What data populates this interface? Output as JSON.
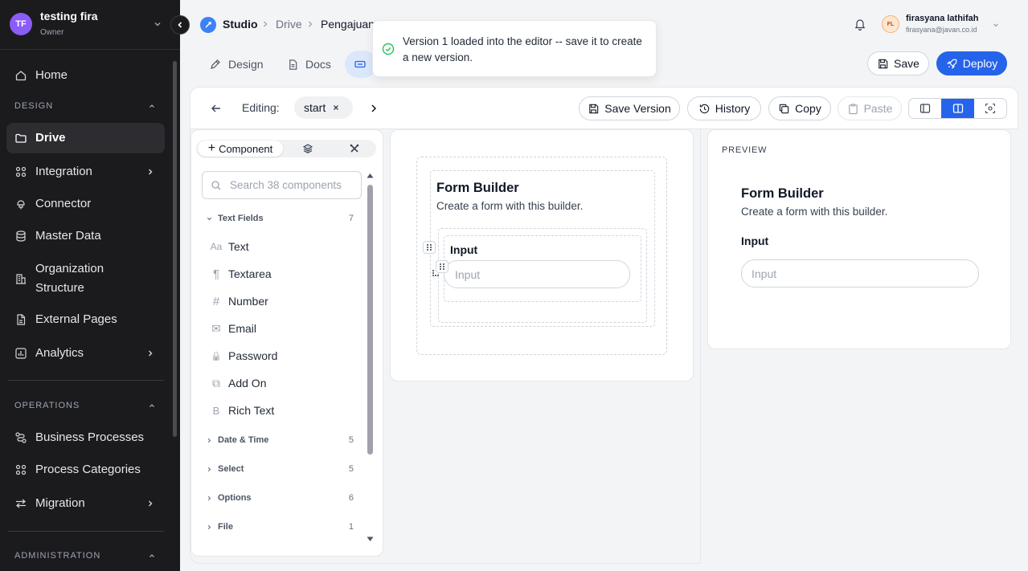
{
  "workspace": {
    "initials": "TF",
    "name": "testing fira",
    "role": "Owner"
  },
  "sidebar": {
    "home": "Home",
    "sections": {
      "design": "DESIGN",
      "operations": "OPERATIONS",
      "administration": "ADMINISTRATION"
    },
    "design_items": [
      {
        "label": "Drive",
        "icon": "folder-icon",
        "active": true
      },
      {
        "label": "Integration",
        "icon": "grid-icon"
      },
      {
        "label": "Connector",
        "icon": "plug-icon"
      },
      {
        "label": "Master Data",
        "icon": "database-icon"
      },
      {
        "label": "Organization Structure",
        "icon": "building-icon"
      },
      {
        "label": "External Pages",
        "icon": "file-icon"
      },
      {
        "label": "Analytics",
        "icon": "chart-icon"
      }
    ],
    "operations_items": [
      {
        "label": "Business Processes",
        "icon": "workflow-icon"
      },
      {
        "label": "Process Categories",
        "icon": "grid-icon"
      },
      {
        "label": "Migration",
        "icon": "arrows-icon"
      }
    ]
  },
  "header": {
    "app": "Studio",
    "breadcrumb": [
      "Drive",
      "Pengajuan"
    ],
    "user": {
      "initials": "FL",
      "name": "firasyana lathifah",
      "email": "firasyana@javan.co.id"
    }
  },
  "tabs": {
    "design": "Design",
    "docs": "Docs"
  },
  "actions": {
    "save": "Save",
    "deploy": "Deploy"
  },
  "toast": {
    "message": "Version 1 loaded into the editor -- save it to create a new version."
  },
  "editor": {
    "editing_label": "Editing:",
    "chip": "start",
    "toolbar": {
      "save_version": "Save Version",
      "history": "History",
      "copy": "Copy",
      "paste": "Paste"
    }
  },
  "component_panel": {
    "tab_label": "Component",
    "search_placeholder": "Search 38 components",
    "categories": [
      {
        "name": "Text Fields",
        "count": "7"
      },
      {
        "name": "Date & Time",
        "count": "5"
      },
      {
        "name": "Select",
        "count": "5"
      },
      {
        "name": "Options",
        "count": "6"
      },
      {
        "name": "File",
        "count": "1"
      }
    ],
    "text_field_items": [
      {
        "label": "Text",
        "glyph": "Aa"
      },
      {
        "label": "Textarea",
        "glyph": "¶"
      },
      {
        "label": "Number",
        "glyph": "#"
      },
      {
        "label": "Email",
        "glyph": "✉"
      },
      {
        "label": "Password",
        "glyph": "🔒"
      },
      {
        "label": "Add On",
        "glyph": "⧉"
      },
      {
        "label": "Rich Text",
        "glyph": "B"
      }
    ]
  },
  "canvas": {
    "form_title": "Form Builder",
    "form_subtitle": "Create a form with this builder.",
    "input_label": "Input",
    "input_placeholder": "Input"
  },
  "preview": {
    "label": "PREVIEW",
    "form_title": "Form Builder",
    "form_subtitle": "Create a form with this builder.",
    "input_label": "Input",
    "input_placeholder": "Input"
  }
}
